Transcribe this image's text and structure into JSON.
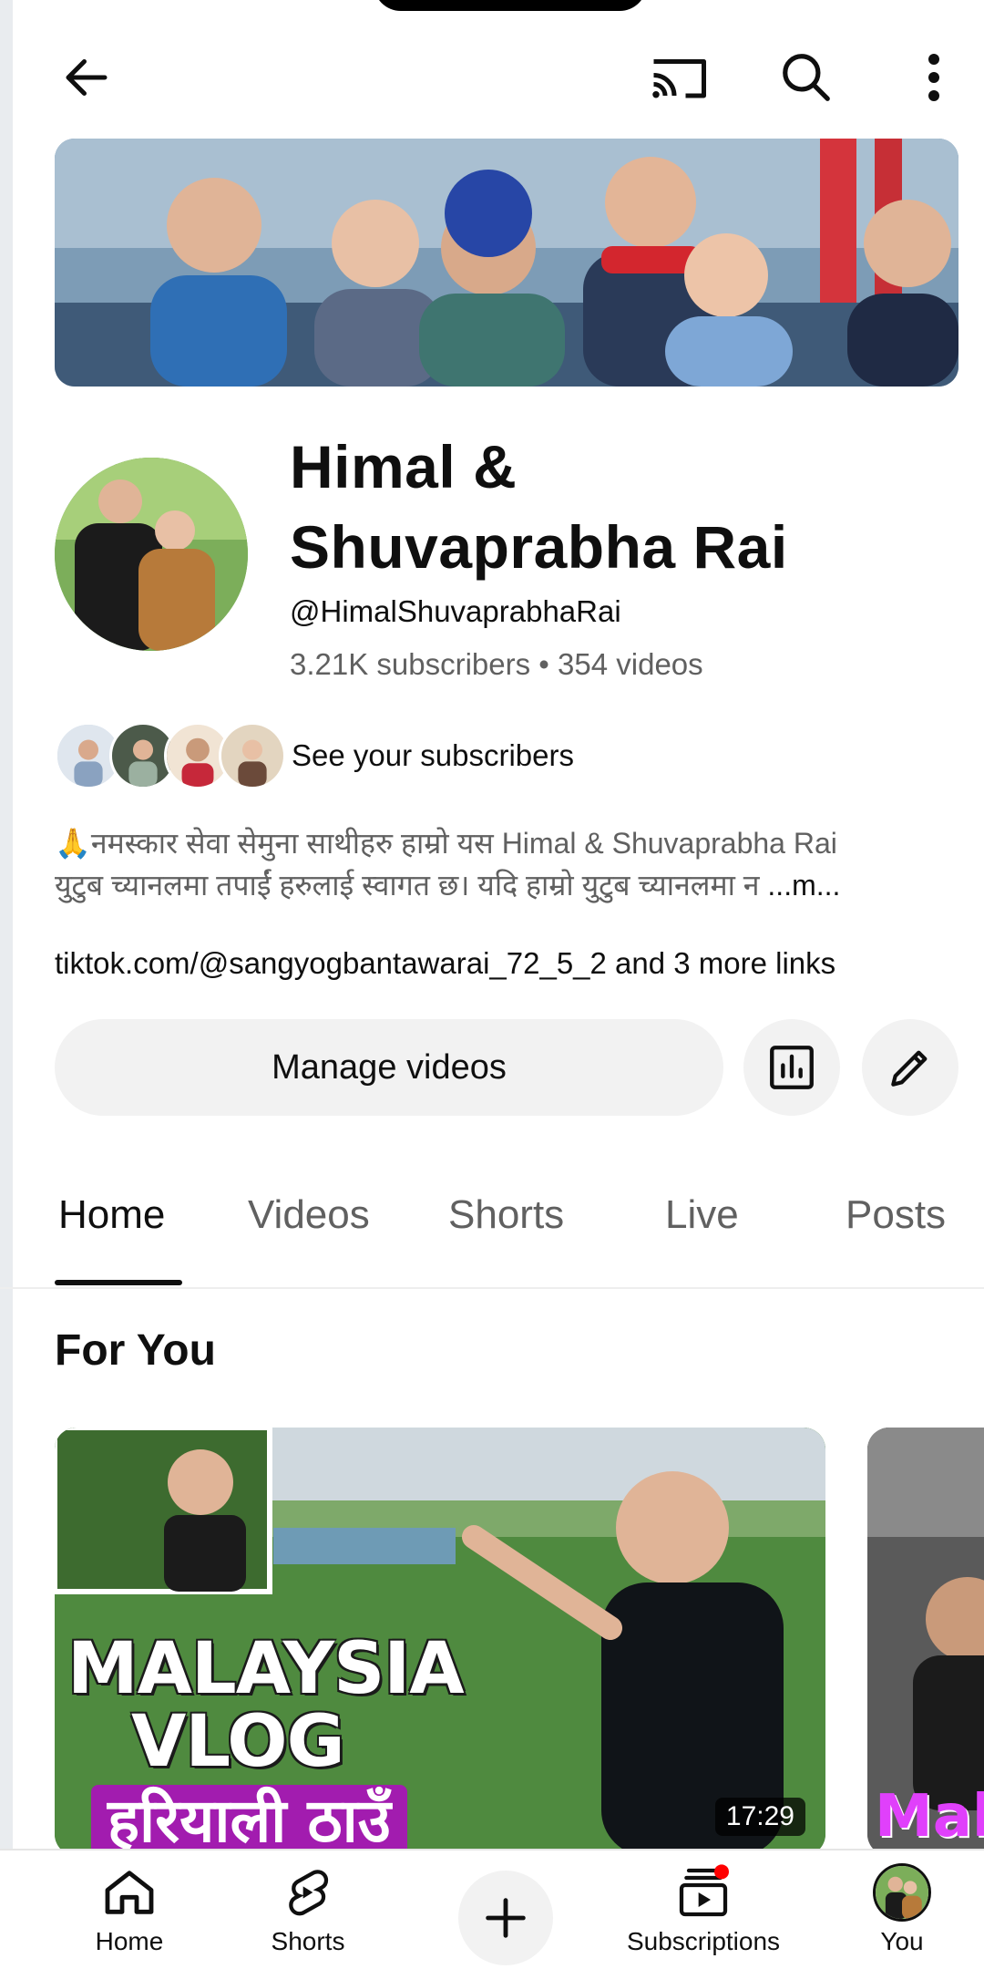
{
  "topbar": {
    "icons": [
      "back-arrow-icon",
      "cast-icon",
      "search-icon",
      "more-vertical-icon"
    ]
  },
  "channel": {
    "name_line1": "Himal &",
    "name_line2": "Shuvaprabha Rai",
    "handle": "@HimalShuvaprabhaRai",
    "subscribers": "3.21K subscribers",
    "separator": " • ",
    "videos": "354 videos",
    "see_subscribers": "See your subscribers",
    "description_line1": "🙏नमस्कार सेवा सेमुना साथीहरु हाम्रो यस Himal & Shuvaprabha Rai",
    "description_line2": "युटुब च्यानलमा तपाईं हरुलाई स्वागत छ। यदि हाम्रो युटुब च्यानलमा न",
    "description_more": " ...m...",
    "links": "tiktok.com/@sangyogbantawarai_72_5_2 and 3 more links"
  },
  "actions": {
    "manage_videos": "Manage videos",
    "analytics_icon": "analytics-icon",
    "edit_icon": "pencil-icon"
  },
  "tabs": [
    {
      "label": "Home",
      "active": true
    },
    {
      "label": "Videos",
      "active": false
    },
    {
      "label": "Shorts",
      "active": false
    },
    {
      "label": "Live",
      "active": false
    },
    {
      "label": "Posts",
      "active": false
    }
  ],
  "section": {
    "title": "For You"
  },
  "videos": [
    {
      "thumb_line1": "MALAYSIA",
      "thumb_line2": "VLOG",
      "thumb_line3": "हरियाली ठाउँ",
      "duration": "17:29"
    },
    {
      "thumb_text": "Mala"
    }
  ],
  "bottom_nav": [
    {
      "label": "Home",
      "icon": "home-icon"
    },
    {
      "label": "Shorts",
      "icon": "shorts-icon"
    },
    {
      "label": "",
      "icon": "create-plus-icon"
    },
    {
      "label": "Subscriptions",
      "icon": "subscriptions-icon"
    },
    {
      "label": "You",
      "icon": "avatar"
    }
  ],
  "colors": {
    "text_primary": "#0f0f0f",
    "text_secondary": "#606060",
    "button_bg": "#f2f2f2",
    "notification_dot": "#ff0000"
  }
}
